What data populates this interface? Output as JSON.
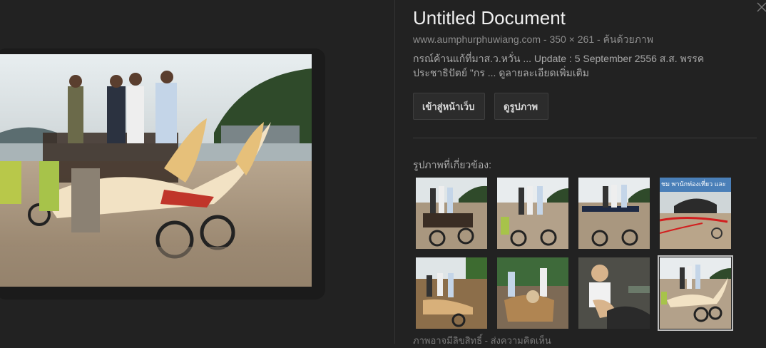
{
  "title": "Untitled Document",
  "meta": {
    "domain": "www.aumphurphuwiang.com",
    "sep1": " - ",
    "dimensions": "350 × 261",
    "sep2": " - ",
    "search_by_image": "ค้นด้วยภาพ"
  },
  "description": "กรณ์ค้านแก้ที่มาส.ว.หวั่น ... Update : 5 September 2556 ส.ส. พรรคประชาธิปัตย์ \"กร ... ดูลายละเอียดเพิ่มเติม",
  "buttons": {
    "visit": "เข้าสู่หน้าเว็บ",
    "view_image": "ดูรูปภาพ"
  },
  "related_label": "รูปภาพที่เกี่ยวข้อง:",
  "thumb_caption": "ชม พานักท่องเที่ยว และ",
  "footer": {
    "copyright": "ภาพอาจมีลิขสิทธิ์",
    "sep": " - ",
    "feedback": "ส่งความคิดเห็น"
  },
  "icons": {
    "close": "close-icon"
  }
}
